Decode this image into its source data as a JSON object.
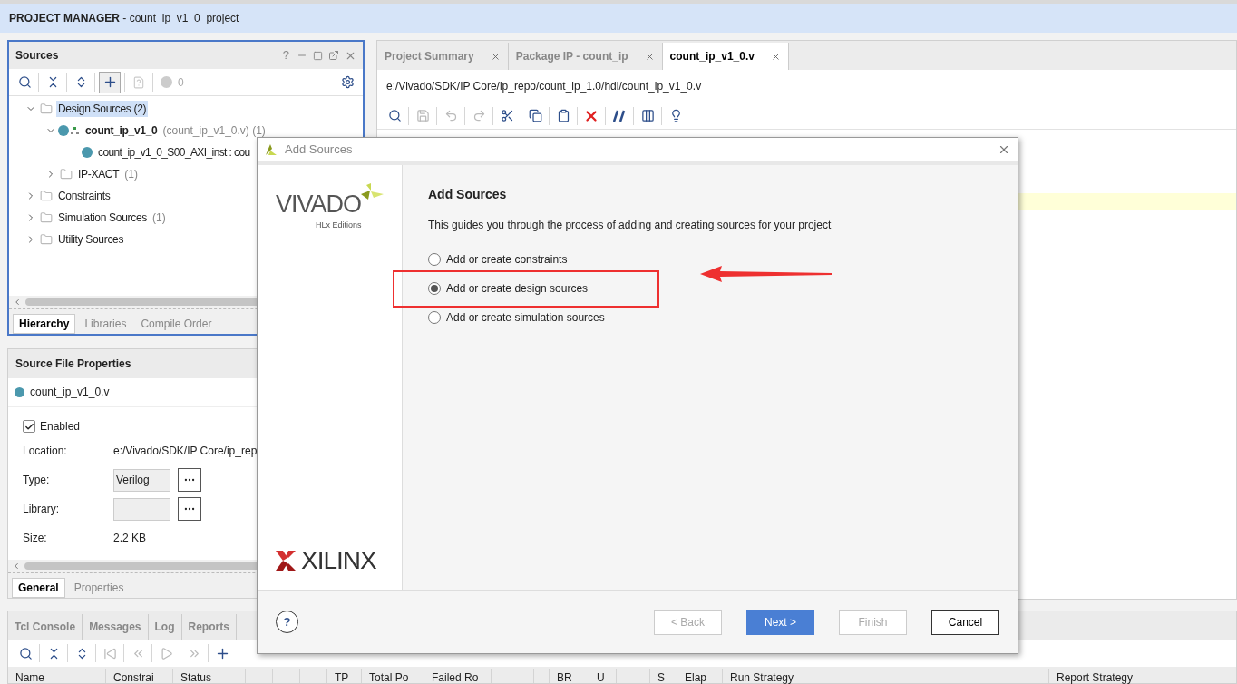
{
  "title_bar": {
    "title": "**PROJECT MANAGER** - count_ip_v1_0_project"
  },
  "sources_panel": {
    "title": "Sources",
    "header_controls": [
      "?"
    ],
    "problem_count": "0",
    "tree": [
      {
        "label": "Design Sources (2)",
        "kind": "folder",
        "expanded": true,
        "selected": true,
        "children": [
          {
            "label": "count_ip_v1_0",
            "suffix": "(count_ip_v1_0.v) (1)",
            "kind": "module",
            "expanded": true,
            "selected": false,
            "children": [
              {
                "label": "count_ip_v1_0_S00_AXI_inst : cou",
                "kind": "instance",
                "selected": false
              }
            ]
          },
          {
            "label": "IP-XACT",
            "suffix": "(1)",
            "kind": "folder",
            "expanded": false,
            "selected": false
          }
        ]
      },
      {
        "label": "Constraints",
        "kind": "folder",
        "expanded": false,
        "selected": false
      },
      {
        "label": "Simulation Sources",
        "suffix": "(1)",
        "kind": "folder",
        "expanded": false,
        "selected": false
      },
      {
        "label": "Utility Sources",
        "kind": "folder",
        "expanded": false,
        "selected": false
      }
    ],
    "tabs": [
      {
        "label": "Hierarchy",
        "selected": true
      },
      {
        "label": "Libraries",
        "selected": false
      },
      {
        "label": "Compile Order",
        "selected": false
      }
    ]
  },
  "properties_panel": {
    "title": "Source File Properties",
    "file": "count_ip_v1_0.v",
    "enabled": {
      "label": "Enabled",
      "checked": true
    },
    "rows": [
      {
        "kind": "text",
        "label": "Location:",
        "value": "e:/Vivado/SDK/IP Core/ip_rep"
      },
      {
        "kind": "field",
        "label": "Type:",
        "value": "Verilog"
      },
      {
        "kind": "field",
        "label": "Library:"
      },
      {
        "kind": "text",
        "label": "Size:",
        "value": "2.2 KB"
      }
    ],
    "tabs": [
      {
        "label": "General",
        "selected": true
      },
      {
        "label": "Properties",
        "selected": false
      }
    ]
  },
  "editor": {
    "tabs": [
      {
        "label": "Project Summary",
        "selected": false
      },
      {
        "label": "Package IP - count_ip",
        "selected": false
      },
      {
        "label": "count_ip_v1_0.v",
        "selected": true
      }
    ],
    "path": "e:/Vivado/SDK/IP Core/ip_repo/count_ip_1.0/hdl/count_ip_v1_0.v"
  },
  "console": {
    "tabs": [
      {
        "label": "Tcl Console",
        "selected": false
      },
      {
        "label": "Messages",
        "selected": false
      },
      {
        "label": "Log",
        "selected": false
      },
      {
        "label": "Reports",
        "selected": false
      }
    ],
    "columns": [
      "Name",
      "Constrai",
      "Status",
      null,
      null,
      null,
      "TP",
      "Total Po",
      "Failed Ro",
      null,
      null,
      "BR",
      "U",
      null,
      "S",
      "Elap",
      "Run Strategy",
      "Report Strategy"
    ]
  },
  "dialog": {
    "title": "Add Sources",
    "logo_top": {
      "wordmark": "VIVADO",
      "subtitle": "HLx Editions"
    },
    "logo_bottom": "XILINX",
    "heading": "Add Sources",
    "description": "This guides you through the process of adding and creating sources for your project",
    "options": [
      {
        "label": "Add or create constraints",
        "selected": false
      },
      {
        "label": "Add or create design sources",
        "selected": true
      },
      {
        "label": "Add or create simulation sources",
        "selected": false
      }
    ],
    "help": "?",
    "buttons": [
      {
        "label": "< Back",
        "kind": "default",
        "disabled": true
      },
      {
        "label": "Next >",
        "kind": "primary",
        "disabled": false
      },
      {
        "label": "Finish",
        "kind": "default",
        "disabled": true
      },
      {
        "label": "Cancel",
        "kind": "default",
        "disabled": false
      }
    ]
  }
}
